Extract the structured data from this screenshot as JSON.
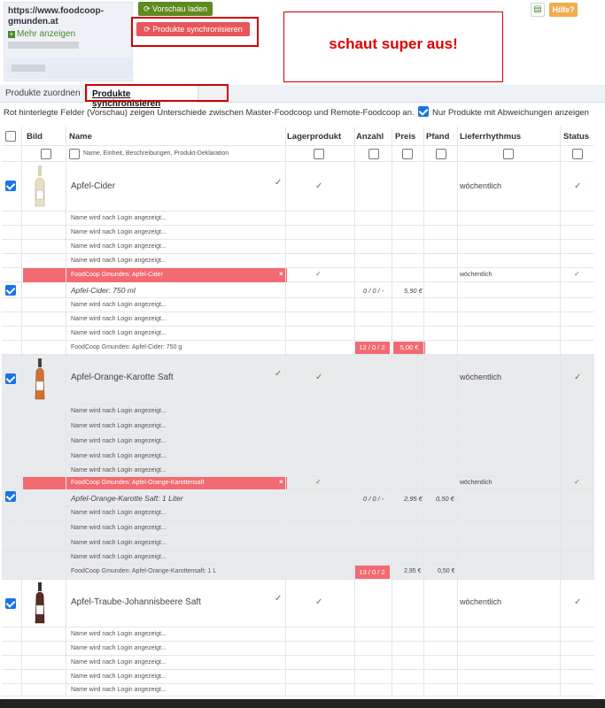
{
  "site": {
    "url": "https://www.foodcoop-gmunden.at",
    "more": "Mehr anzeigen"
  },
  "buttons": {
    "preview": "Vorschau laden",
    "sync": "Produkte synchronisieren",
    "help": "Hilfe?"
  },
  "comment": "schaut super aus!",
  "tabs": [
    "Produkte zuordnen",
    "Produkte synchronisieren"
  ],
  "info": {
    "text": "Rot hinterlegte Felder (Vorschau) zeigen Unterschiede zwischen Master-Foodcoop und Remote-Foodcoop an.",
    "filter_label": "Nur Produkte mit Abweichungen anzeigen"
  },
  "table": {
    "headers": {
      "bild": "Bild",
      "name": "Name",
      "lager": "Lagerprodukt",
      "anzahl": "Anzahl",
      "preis": "Preis",
      "pfand": "Pfand",
      "lieferrhythmus": "Lieferrhythmus",
      "status": "Status"
    },
    "name_filter": "Name, Einheit, Beschreibungen, Produkt-Deklaration",
    "placeholder_row": "Name wird nach Login angezeigt...",
    "products": [
      {
        "name": "Apfel-Cider",
        "rhythm": "wöchentlich",
        "remote_label": "FoodCoop Gmunden:  Apfel-Cider",
        "remote_rhythm": "wöchentlich",
        "master_line": "Apfel-Cider: 750 ml",
        "master_anzahl": "0 / 0 / -",
        "master_preis": "5,90 €",
        "master_pfand": "",
        "remote_line": "FoodCoop Gmunden:  Apfel-Cider: 750 g",
        "remote_anzahl": "12 / 0 / 2",
        "remote_preis": "5,00 €",
        "remote_pfand": ""
      },
      {
        "name": "Apfel-Orange-Karotte Saft",
        "rhythm": "wöchentlich",
        "remote_label": "FoodCoop Gmunden:  Apfel-Orange-Karottensaft",
        "remote_rhythm": "wöchentlich",
        "master_line": "Apfel-Orange-Karotte Saft: 1 Liter",
        "master_anzahl": "0 / 0 / -",
        "master_preis": "2,95 €",
        "master_pfand": "0,50 €",
        "remote_line": "FoodCoop Gmunden:  Apfel-Orange-Karottensaft: 1 L",
        "remote_anzahl": "13 / 0 / 2",
        "remote_preis": "2,95 €",
        "remote_pfand": "0,50 €"
      },
      {
        "name": "Apfel-Traube-Johannisbeere Saft",
        "rhythm": "wöchentlich"
      }
    ]
  }
}
